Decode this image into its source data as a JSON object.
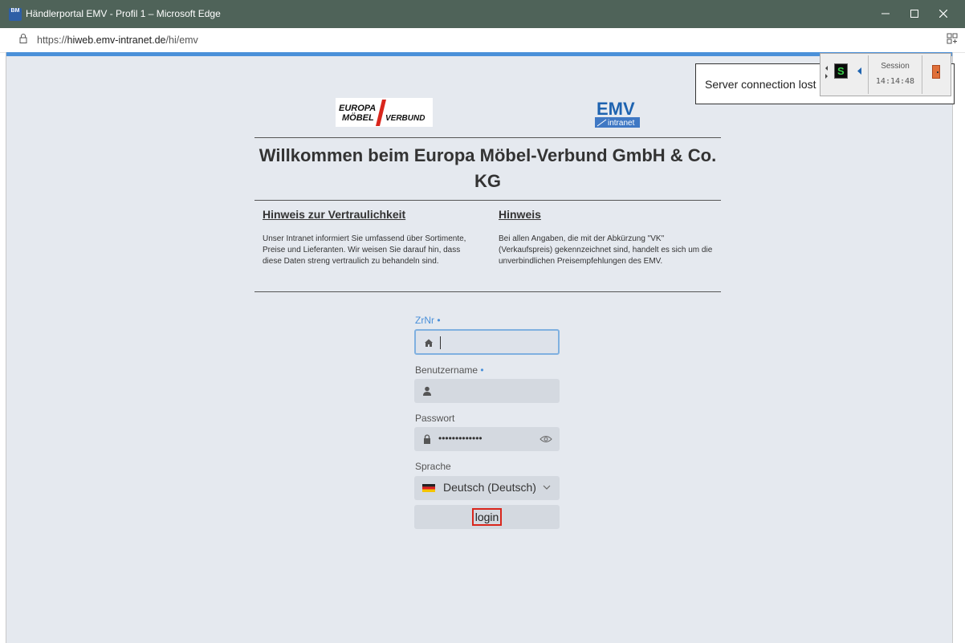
{
  "window": {
    "title": "Händlerportal EMV - Profil 1 – Microsoft Edge",
    "app_icon_text": "BM",
    "controls": [
      "minimize",
      "maximize",
      "close"
    ]
  },
  "addressbar": {
    "url_prefix": "https://",
    "url_host": "hiweb.emv-intranet.de",
    "url_path": "/hi/emv"
  },
  "logos": {
    "left": {
      "line1": "EUROPA",
      "line2": "MÖBEL",
      "line3": "VERBUND"
    },
    "right": {
      "main": "EMV",
      "sub": "intranet"
    }
  },
  "welcome_title": "Willkommen beim Europa Möbel-Verbund GmbH & Co. KG",
  "hints": [
    {
      "title": "Hinweis zur Vertraulichkeit",
      "text": "Unser Intranet informiert Sie umfassend über Sortimente, Preise und Lieferanten. Wir weisen Sie darauf hin, dass diese Daten streng vertraulich zu behandeln sind."
    },
    {
      "title": "Hinweis",
      "text": "Bei allen Angaben, die mit der Abkürzung \"VK\" (Verkaufspreis) gekennzeichnet sind, handelt es sich um die unverbindlichen Preisempfehlungen des EMV."
    }
  ],
  "form": {
    "zrnr": {
      "label": "ZrNr",
      "required_marker": "•",
      "value": ""
    },
    "username": {
      "label": "Benutzername",
      "required_marker": "•",
      "value": ""
    },
    "password": {
      "label": "Passwort",
      "masked_value": "•••••••••••••"
    },
    "language": {
      "label": "Sprache",
      "selected": "Deutsch (Deutsch)"
    },
    "login_label": "login"
  },
  "session": {
    "notice": "Server connection lost",
    "label": "Session",
    "time": "14:14:48",
    "s_button": "S"
  },
  "colors": {
    "titlebar": "#4f6359",
    "accent": "#4a90d9",
    "content_bg": "#e5e9ef",
    "highlight": "#d9261c"
  }
}
